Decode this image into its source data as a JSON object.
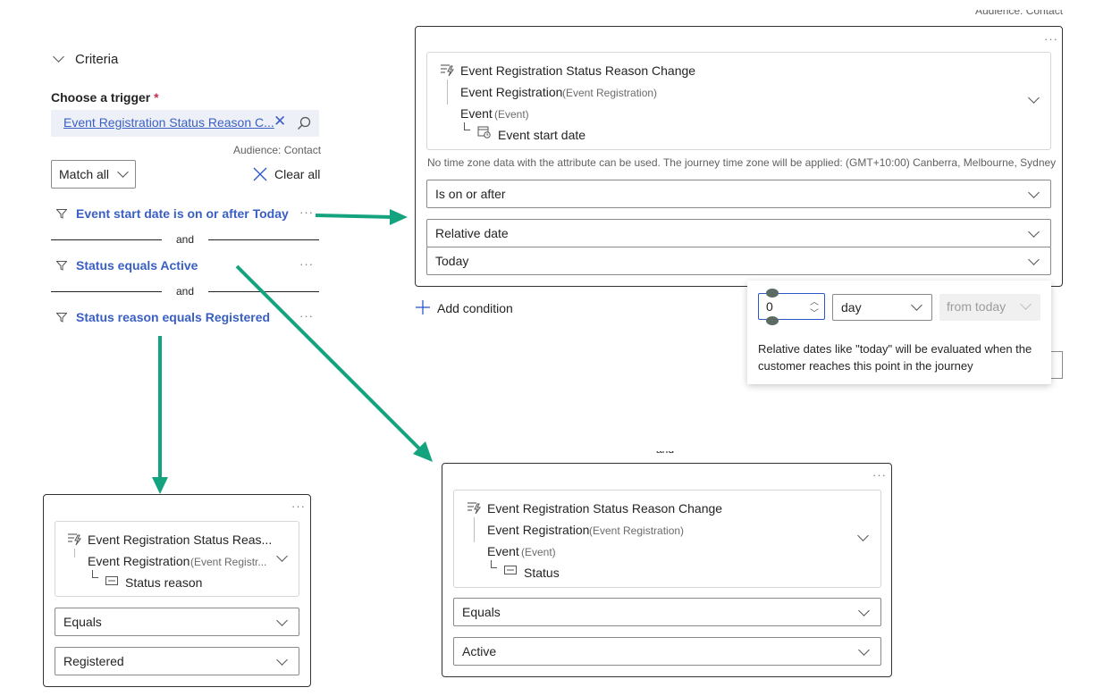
{
  "left": {
    "section_title": "Criteria",
    "trigger_label": "Choose a trigger",
    "required_mark": "*",
    "trigger_value": "Event Registration Status Reason C...",
    "audience": "Audience: Contact",
    "match_all": "Match all",
    "clear_all": "Clear all",
    "conditions": [
      {
        "label": "Event start date is on or after Today"
      },
      {
        "label": "Status equals Active"
      },
      {
        "label": "Status reason equals Registered"
      }
    ],
    "and": "and"
  },
  "panel_date": {
    "top_cut_text": "Audience: Contact",
    "trigger": "Event Registration Status Reason Change",
    "entity1": "Event Registration",
    "entity1_sub": "(Event Registration)",
    "entity2": "Event",
    "entity2_sub": "(Event)",
    "attribute": "Event start date",
    "timezone_note": "No time zone data with the attribute can be used. The journey time zone will be applied: (GMT+10:00) Canberra, Melbourne, Sydney",
    "operator": "Is on or after",
    "value_type": "Relative date",
    "value": "Today",
    "add_condition": "Add condition"
  },
  "popup": {
    "number": "0",
    "unit": "day",
    "direction": "from today",
    "note": "Relative dates like \"today\" will be evaluated when the customer reaches this point in the journey"
  },
  "panel_status": {
    "trigger": "Event Registration Status Reason Change",
    "entity1": "Event Registration",
    "entity1_sub": "(Event Registration)",
    "entity2": "Event",
    "entity2_sub": "(Event)",
    "attribute": "Status",
    "operator": "Equals",
    "value": "Active"
  },
  "panel_reason": {
    "trigger": "Event Registration Status Reas...",
    "entity1": "Event Registration",
    "entity1_sub": "(Event Registr...",
    "attribute": "Status reason",
    "operator": "Equals",
    "value": "Registered"
  },
  "colors": {
    "arrow": "#14a37f",
    "link": "#3a5fc4",
    "accent": "#2b57c8"
  }
}
